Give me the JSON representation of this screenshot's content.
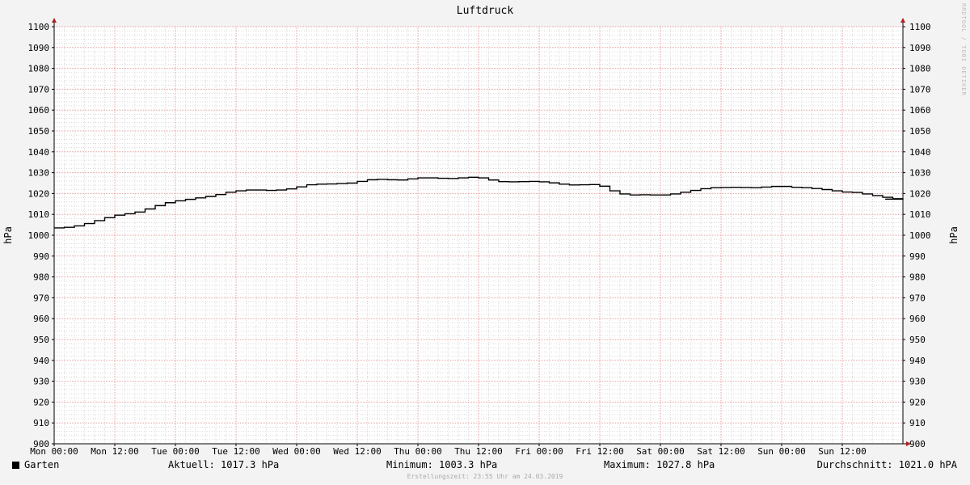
{
  "chart_data": {
    "type": "line",
    "title": "Luftdruck",
    "ylabel": "hPa",
    "ylabel_right": "hPa",
    "ylim": [
      900,
      1100
    ],
    "yticks": [
      900,
      910,
      920,
      930,
      940,
      950,
      960,
      970,
      980,
      990,
      1000,
      1010,
      1020,
      1030,
      1040,
      1050,
      1060,
      1070,
      1080,
      1090,
      1100
    ],
    "xlim": [
      0,
      168
    ],
    "x_unit": "hours since Mon 00:00",
    "xticks": [
      {
        "x": 0,
        "label": "Mon 00:00"
      },
      {
        "x": 12,
        "label": "Mon 12:00"
      },
      {
        "x": 24,
        "label": "Tue 00:00"
      },
      {
        "x": 36,
        "label": "Tue 12:00"
      },
      {
        "x": 48,
        "label": "Wed 00:00"
      },
      {
        "x": 60,
        "label": "Wed 12:00"
      },
      {
        "x": 72,
        "label": "Thu 00:00"
      },
      {
        "x": 84,
        "label": "Thu 12:00"
      },
      {
        "x": 96,
        "label": "Fri 00:00"
      },
      {
        "x": 108,
        "label": "Fri 12:00"
      },
      {
        "x": 120,
        "label": "Sat 00:00"
      },
      {
        "x": 132,
        "label": "Sat 12:00"
      },
      {
        "x": 144,
        "label": "Sun 00:00"
      },
      {
        "x": 156,
        "label": "Sun 12:00"
      }
    ],
    "grid": true,
    "series": [
      {
        "name": "Garten",
        "color": "#000000",
        "x": [
          0,
          2,
          4,
          6,
          8,
          10,
          12,
          14,
          16,
          18,
          20,
          22,
          24,
          26,
          28,
          30,
          32,
          34,
          36,
          38,
          40,
          42,
          44,
          46,
          48,
          50,
          52,
          54,
          56,
          58,
          60,
          62,
          64,
          66,
          68,
          70,
          72,
          74,
          76,
          78,
          80,
          82,
          84,
          86,
          88,
          90,
          92,
          94,
          96,
          98,
          100,
          102,
          104,
          106,
          108,
          110,
          112,
          114,
          116,
          118,
          120,
          122,
          124,
          126,
          128,
          130,
          132,
          134,
          136,
          138,
          140,
          142,
          144,
          146,
          148,
          150,
          152,
          154,
          156,
          158,
          160,
          162,
          164,
          166,
          168
        ],
        "values": [
          1003.5,
          1003.8,
          1004.5,
          1005.6,
          1007.0,
          1008.4,
          1009.6,
          1010.3,
          1011.1,
          1012.6,
          1014.2,
          1015.6,
          1016.5,
          1017.2,
          1017.9,
          1018.6,
          1019.5,
          1020.6,
          1021.3,
          1021.7,
          1021.7,
          1021.5,
          1021.7,
          1022.2,
          1023.2,
          1024.2,
          1024.5,
          1024.6,
          1024.8,
          1025.0,
          1025.8,
          1026.6,
          1026.8,
          1026.6,
          1026.5,
          1027.0,
          1027.5,
          1027.5,
          1027.3,
          1027.2,
          1027.5,
          1027.8,
          1027.5,
          1026.5,
          1025.7,
          1025.6,
          1025.7,
          1025.8,
          1025.6,
          1025.1,
          1024.5,
          1024.1,
          1024.2,
          1024.3,
          1023.5,
          1021.3,
          1019.8,
          1019.3,
          1019.4,
          1019.3,
          1019.3,
          1019.8,
          1020.6,
          1021.5,
          1022.3,
          1022.8,
          1022.9,
          1023.0,
          1022.9,
          1022.8,
          1023.1,
          1023.4,
          1023.4,
          1023.0,
          1022.8,
          1022.4,
          1021.9,
          1021.3,
          1020.7,
          1020.5,
          1019.8,
          1019.0,
          1018.2,
          1017.5,
          1017.3
        ]
      }
    ]
  },
  "legend": {
    "series_label": "Garten",
    "aktuell": "Aktuell: 1017.3 hPa",
    "minimum": "Minimum: 1003.3 hPa",
    "maximum": "Maximum: 1027.8 hPa",
    "durchschnitt": "Durchschnitt: 1021.0 hPA"
  },
  "footer": {
    "created": "Erstellungszeit: 23:55 Uhr am 24.03.2019",
    "watermark": "RRDTOOL / TOBI OETIKER"
  },
  "colors": {
    "background": "#f3f3f3",
    "plot_background": "#ffffff",
    "major_grid": "#e8a0a0",
    "minor_grid": "#d8d8d8",
    "axis_arrow": "#b02020",
    "line": "#000000"
  }
}
